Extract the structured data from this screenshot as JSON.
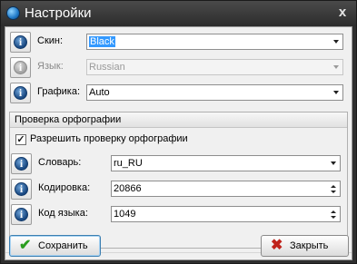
{
  "window": {
    "title": "Настройки",
    "close_glyph": "x"
  },
  "general": {
    "skin": {
      "label": "Скин:",
      "value": "Black",
      "enabled": true
    },
    "language": {
      "label": "Язык:",
      "value": "Russian",
      "enabled": false
    },
    "graphics": {
      "label": "Графика:",
      "value": "Auto",
      "enabled": true
    }
  },
  "spelling": {
    "title": "Проверка орфографии",
    "enable_label": "Разрешить проверку орфографии",
    "enabled": true,
    "dictionary": {
      "label": "Словарь:",
      "value": "ru_RU"
    },
    "encoding": {
      "label": "Кодировка:",
      "value": "20866"
    },
    "language_code": {
      "label": "Код языка:",
      "value": "1049"
    }
  },
  "buttons": {
    "save": "Сохранить",
    "close": "Закрыть"
  },
  "icons": {
    "info": "info-icon",
    "save": "check-icon",
    "close": "cross-icon",
    "app": "app-icon"
  },
  "colors": {
    "save_check": "#2a9d1f",
    "close_x": "#c0231b",
    "selection": "#3399ff"
  }
}
